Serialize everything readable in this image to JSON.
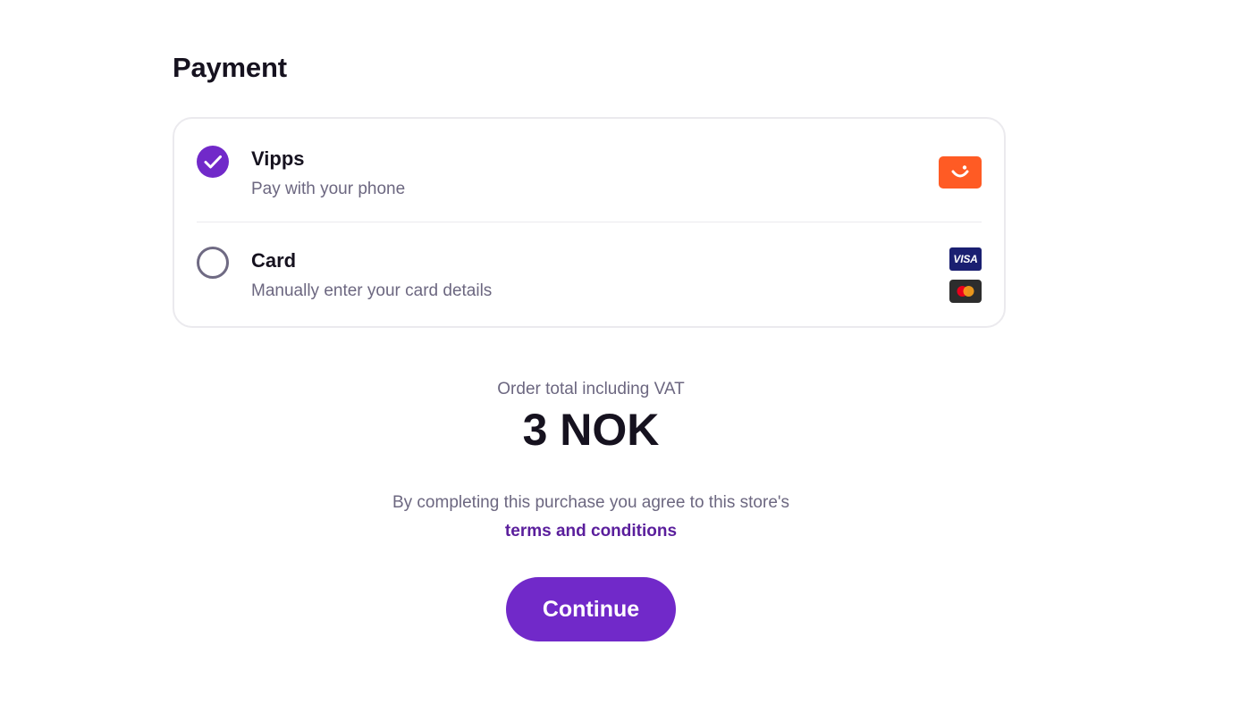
{
  "payment": {
    "heading": "Payment",
    "methods": [
      {
        "id": "vipps",
        "title": "Vipps",
        "description": "Pay with your phone",
        "selected": true,
        "logo_icon": "vipps-logo-icon",
        "logo_color": "#ff5b24"
      },
      {
        "id": "card",
        "title": "Card",
        "description": "Manually enter your card details",
        "selected": false,
        "logos": [
          {
            "icon": "visa-logo-icon",
            "text": "VISA",
            "color": "#1a1f71"
          },
          {
            "icon": "mastercard-logo-icon",
            "color": "#2d2d2d"
          }
        ]
      }
    ]
  },
  "order": {
    "total_label": "Order total including VAT",
    "total_amount": "3 NOK"
  },
  "agreement": {
    "text": "By completing this purchase you agree to this store's",
    "link_label": "terms and conditions"
  },
  "actions": {
    "continue_label": "Continue"
  },
  "colors": {
    "accent": "#7129c9",
    "link": "#5a1e9c",
    "text_primary": "#16121f",
    "text_secondary": "#6c6780",
    "border": "#ebeaee"
  }
}
